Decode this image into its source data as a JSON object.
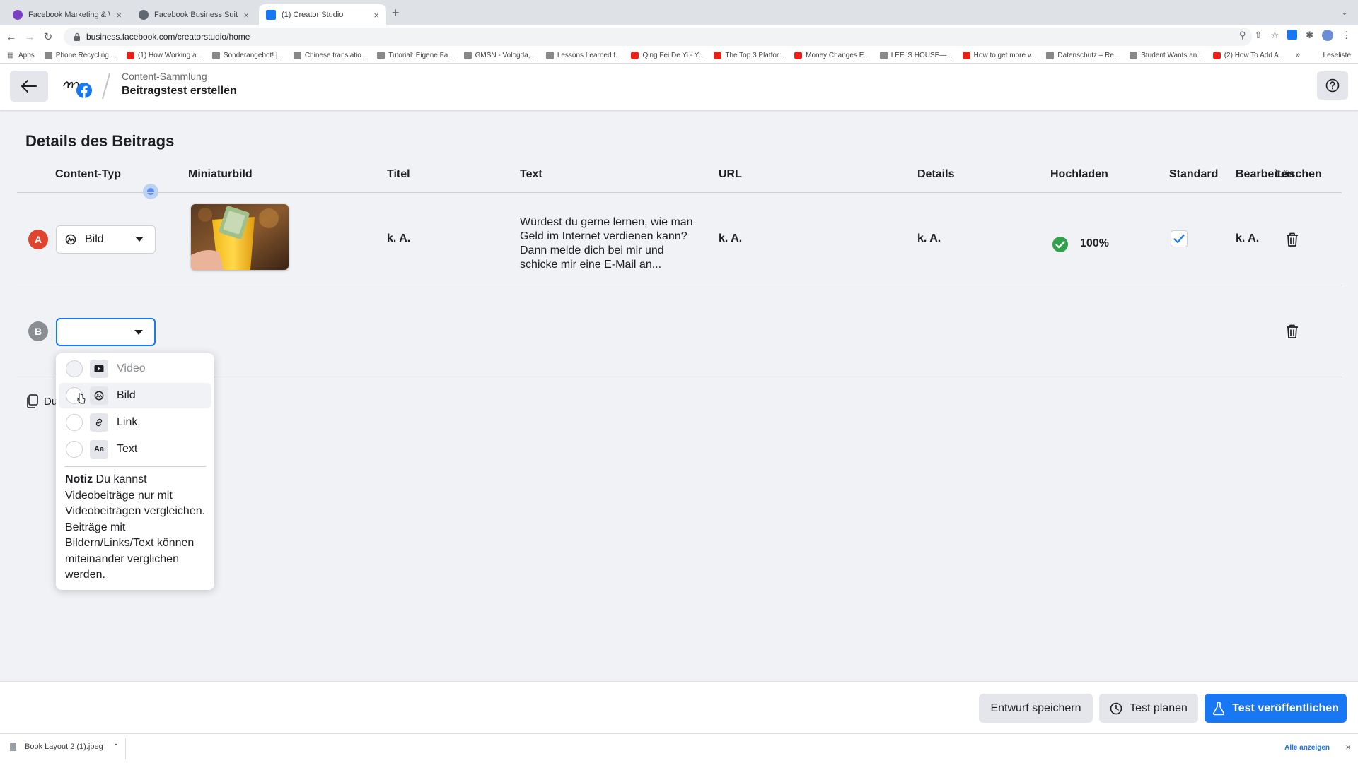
{
  "browser": {
    "tabs": [
      {
        "title": "Facebook Marketing & Werbe...",
        "favicon_color": "#7b3fc4",
        "active": false
      },
      {
        "title": "Facebook Business Suite",
        "favicon_color": "#606770",
        "active": false
      },
      {
        "title": "(1) Creator Studio",
        "favicon_color": "#1877f2",
        "active": true
      }
    ],
    "tab_close": "×",
    "new_tab": "+",
    "tab_menu": "⌄",
    "url": "business.facebook.com/creatorstudio/home",
    "bookmarks": [
      {
        "label": "Apps",
        "type": "grid"
      },
      {
        "label": "Phone Recycling,...",
        "type": "site"
      },
      {
        "label": "(1) How Working a...",
        "type": "youtube"
      },
      {
        "label": "Sonderangebot! |...",
        "type": "site"
      },
      {
        "label": "Chinese translatio...",
        "type": "site"
      },
      {
        "label": "Tutorial: Eigene Fa...",
        "type": "site"
      },
      {
        "label": "GMSN - Vologda,...",
        "type": "site"
      },
      {
        "label": "Lessons Learned f...",
        "type": "site"
      },
      {
        "label": "Qing Fei De Yi - Y...",
        "type": "youtube"
      },
      {
        "label": "The Top 3 Platfor...",
        "type": "youtube"
      },
      {
        "label": "Money Changes E...",
        "type": "youtube"
      },
      {
        "label": "LEE 'S HOUSE—...",
        "type": "site"
      },
      {
        "label": "How to get more v...",
        "type": "youtube"
      },
      {
        "label": "Datenschutz – Re...",
        "type": "site"
      },
      {
        "label": "Student Wants an...",
        "type": "site"
      },
      {
        "label": "(2) How To Add A...",
        "type": "youtube"
      }
    ],
    "bookmarks_more": "»",
    "reading_list": "Leseliste"
  },
  "header": {
    "breadcrumb_parent": "Content-Sammlung",
    "page_title": "Beitragstest erstellen"
  },
  "main": {
    "section_title": "Details des Beitrags",
    "columns": [
      "Content-Typ",
      "Miniaturbild",
      "Titel",
      "Text",
      "URL",
      "Details",
      "Hochladen",
      "Standard",
      "Bearbeiten",
      "Löschen"
    ],
    "rows": [
      {
        "badge": "A",
        "badge_color": "#e0442c",
        "content_type": "Bild",
        "title": "k. A.",
        "text": "Würdest du gerne lernen, wie man Geld im Internet verdienen kann? Dann melde dich bei mir und schicke mir eine E-Mail an...",
        "url": "k. A.",
        "details": "k. A.",
        "upload": "100%",
        "standard_checked": true,
        "edit": "k. A."
      },
      {
        "badge": "B",
        "badge_color": "#8a8d91",
        "content_type": ""
      }
    ],
    "duplicate_label": "Du"
  },
  "dropdown": {
    "options": [
      {
        "label": "Video",
        "icon": "video-icon",
        "disabled": true
      },
      {
        "label": "Bild",
        "icon": "image-icon",
        "disabled": false
      },
      {
        "label": "Link",
        "icon": "link-icon",
        "disabled": false
      },
      {
        "label": "Text",
        "icon": "text-icon",
        "icon_text": "Aa",
        "disabled": false
      }
    ],
    "note_label": "Notiz",
    "note_text": " Du kannst Videobeiträge nur mit Videobeiträgen vergleichen. Beiträge mit Bildern/Links/Text können miteinander verglichen werden."
  },
  "footer": {
    "save_draft": "Entwurf speichern",
    "schedule_test": "Test planen",
    "publish_test": "Test veröffentlichen"
  },
  "downloads": {
    "file": "Book Layout 2 (1).jpeg",
    "show_all": "Alle anzeigen",
    "close": "×"
  },
  "colors": {
    "primary": "#1877f2",
    "success": "#31a24c",
    "background": "#f0f2f5"
  }
}
